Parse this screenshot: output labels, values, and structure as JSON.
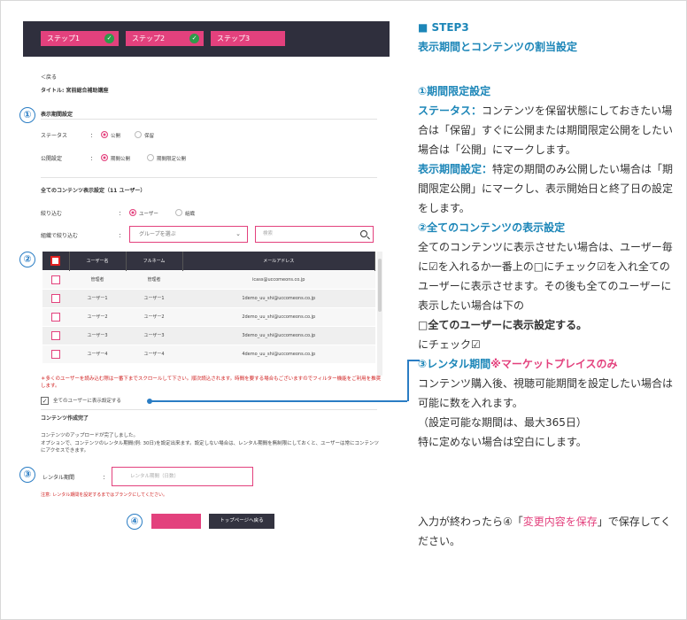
{
  "stepbar": {
    "steps": [
      {
        "label": "ステップ1",
        "done": true
      },
      {
        "label": "ステップ2",
        "done": true
      },
      {
        "label": "ステップ3",
        "done": false
      }
    ]
  },
  "form": {
    "back_link": "＜戻る",
    "title": "タイトル: 宮前総合補助講座",
    "period_section": "表示期間設定",
    "status_label": "ステータス",
    "status_options": [
      "公開",
      "保留"
    ],
    "public_label": "公開設定",
    "public_options": [
      "期間公開",
      "期間限定公開"
    ],
    "content_section": "全てのコンテンツ表示設定（11 ユーザー）",
    "filter_label": "絞り込む",
    "filter_options": [
      "ユーザー",
      "組織"
    ],
    "group_label": "組織で絞り込む",
    "group_placeholder": "グループを選ぶ",
    "search_placeholder": "検索",
    "table": {
      "headers": [
        "",
        "ユーザー名",
        "フルネーム",
        "メールアドレス"
      ],
      "rows": [
        [
          "管理者",
          "管理者",
          "icass@uccomeons.co.jp"
        ],
        [
          "ユーザー1",
          "ユーザー1",
          "1demo_uu_shi@uccomeons.co.jp"
        ],
        [
          "ユーザー2",
          "ユーザー2",
          "2demo_uu_shi@uccomeons.co.jp"
        ],
        [
          "ユーザー3",
          "ユーザー3",
          "3demo_uu_shi@uccomeons.co.jp"
        ],
        [
          "ユーザー4",
          "ユーザー4",
          "4demo_uu_shi@uccomeons.co.jp"
        ]
      ]
    },
    "scroll_note": "＊多くのユーザーを読み込む際は一番下までスクロールして下さい。順次読込されます。時間を要する場合もございますのでフィルター機能をご利用を推奨します。",
    "all_users_label": "全てのユーザーに表示設定する",
    "complete_section": "コンテンツ作成完了",
    "complete_note_1": "コンテンツのアップロードが完了しました。",
    "complete_note_2": "オプションで、コンテンツのレンタル期間(例: 30日)を設定出来ます。設定しない場合は、レンタル期間を無制限にしておくと、ユーザーは常にコンテンツにアクセスできます。",
    "rental_label": "レンタル期間",
    "rental_placeholder": "レンタル期間（日数）",
    "rental_note": "注意: レンタル期間を設定するまではブランクにしてください。",
    "save_button": "変更内容を保存",
    "top_button": "トップページへ戻る",
    "colon": "："
  },
  "markers": [
    "①",
    "②",
    "③",
    "④"
  ],
  "explanation": {
    "heading": "■ STEP3",
    "subheading": "表示期間とコンテンツの割当設定",
    "s1_title": "①期間限定設定",
    "s1_status_key": "ステータス：",
    "s1_status_text": "コンテンツを保留状態にしておきたい場合は「保留」すぐに公開または期間限定公開をしたい場合は「公開」にマークします。",
    "s1_period_key": "表示期間設定：",
    "s1_period_text": "特定の期間のみ公開したい場合は「期間限定公開」にマークし、表示開始日と終了日の設定をします。",
    "s2_title": "②全てのコンテンツの表示設定",
    "s2_text": "全てのコンテンツに表示させたい場合は、ユーザー毎に☑を入れるか一番上の□にチェック☑を入れ全てのユーザーに表示させます。その後も全てのユーザーに表示したい場合は下の",
    "s2_bold": "□全てのユーザーに表示設定する。",
    "s2_after": "にチェック☑",
    "s3_title": "③レンタル期間",
    "s3_market": "※マーケットプレイスのみ",
    "s3_text": "コンテンツ購入後、視聴可能期間を設定したい場合は可能に数を入れます。",
    "s3_paren": "（設定可能な期間は、最大365日）",
    "s3_blank": "特に定めない場合は空白にします。",
    "final_before": "入力が終わったら④「",
    "final_link": "変更内容を保存",
    "final_after": "」で保存してください。"
  },
  "colors": {
    "accent_pink": "#e3417d",
    "accent_blue": "#1c86b8",
    "dark_bar": "#2f2f3d"
  }
}
